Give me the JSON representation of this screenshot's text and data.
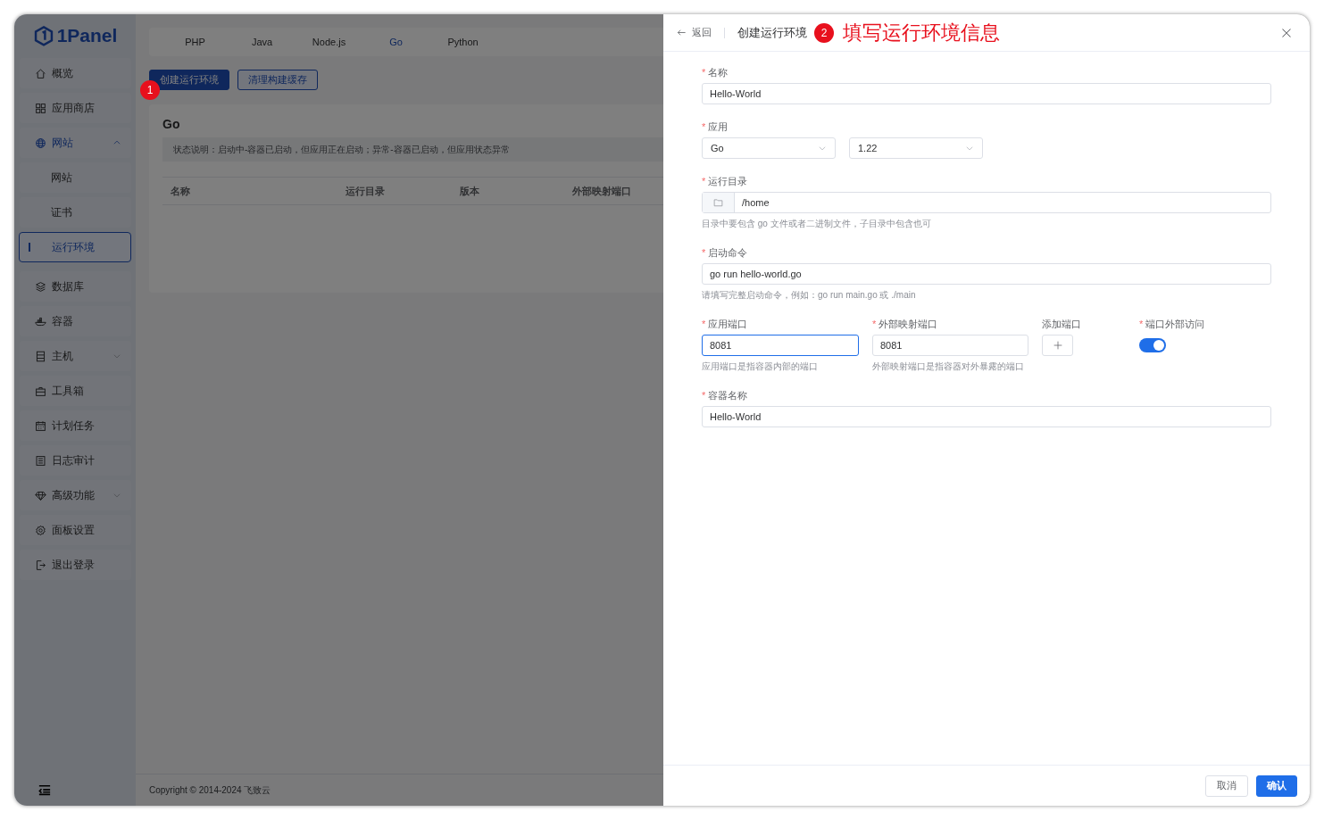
{
  "sidebar": {
    "logo": "1Panel",
    "items": [
      {
        "label": "概览",
        "selected": false
      },
      {
        "label": "应用商店",
        "selected": false
      },
      {
        "label": "网站",
        "selected": false,
        "expanded": true,
        "children": [
          {
            "label": "网站",
            "selected": false
          },
          {
            "label": "证书",
            "selected": false
          },
          {
            "label": "运行环境",
            "selected": true
          }
        ]
      },
      {
        "label": "数据库",
        "selected": false
      },
      {
        "label": "容器",
        "selected": false
      },
      {
        "label": "主机",
        "selected": false,
        "expanded": false
      },
      {
        "label": "工具箱",
        "selected": false
      },
      {
        "label": "计划任务",
        "selected": false
      },
      {
        "label": "日志审计",
        "selected": false
      },
      {
        "label": "高级功能",
        "selected": false,
        "expanded": false
      },
      {
        "label": "面板设置",
        "selected": false
      },
      {
        "label": "退出登录",
        "selected": false
      }
    ]
  },
  "tabs": [
    {
      "label": "PHP",
      "selected": false
    },
    {
      "label": "Java",
      "selected": false
    },
    {
      "label": "Node.js",
      "selected": false
    },
    {
      "label": "Go",
      "selected": true
    },
    {
      "label": "Python",
      "selected": false
    }
  ],
  "toolbar": [
    {
      "label": "创建运行环境",
      "kind": "primary"
    },
    {
      "label": "清理构建缓存",
      "kind": "plain"
    }
  ],
  "card": {
    "title": "Go",
    "notice": "状态说明：启动中-容器已启动，但应用正在启动；异常-容器已启动，但应用状态异常",
    "table": {
      "columns": [
        "名称",
        "运行目录",
        "版本",
        "外部映射端口"
      ]
    }
  },
  "footer": {
    "copyright": "Copyright © 2014-2024 飞致云"
  },
  "annotations": [
    {
      "number": "1"
    },
    {
      "number": "2",
      "text": "填写运行环境信息"
    }
  ],
  "drawer": {
    "back": "返回",
    "title": "创建运行环境",
    "form": [
      {
        "kind": "input",
        "label": "名称",
        "required": "*",
        "value": "Hello-World"
      },
      {
        "kind": "selects",
        "label": "应用",
        "required": "*",
        "options": [
          {
            "value": "Go"
          },
          {
            "value": "1.22"
          }
        ]
      },
      {
        "kind": "folder",
        "label": "运行目录",
        "required": "*",
        "value": "/home",
        "hint": "目录中要包含 go 文件或者二进制文件，子目录中包含也可"
      },
      {
        "kind": "input",
        "label": "启动命令",
        "required": "*",
        "value": "go run hello-world.go",
        "hint": "请填写完整启动命令，例如：go run main.go 或 ./main"
      },
      {
        "kind": "ports",
        "columns": [
          {
            "kind": "input",
            "label": "应用端口",
            "required": "*",
            "value": "8081",
            "focused": true,
            "hint": "应用端口是指容器内部的端口"
          },
          {
            "kind": "input",
            "label": "外部映射端口",
            "required": "*",
            "value": "8081",
            "focused": false,
            "hint": "外部映射端口是指容器对外暴露的端口"
          },
          {
            "kind": "add",
            "label": "添加端口"
          },
          {
            "kind": "switch",
            "label": "端口外部访问",
            "required": "*",
            "on": true
          }
        ]
      },
      {
        "kind": "input",
        "label": "容器名称",
        "required": "*",
        "value": "Hello-World"
      }
    ],
    "buttons": [
      {
        "label": "取消",
        "kind": "plain"
      },
      {
        "label": "确认",
        "kind": "primary"
      }
    ]
  }
}
